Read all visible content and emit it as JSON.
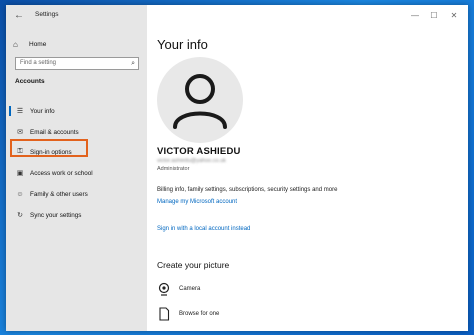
{
  "window": {
    "app_title": "Settings",
    "back_glyph": "←",
    "minimize_glyph": "—",
    "maximize_glyph": "☐",
    "close_glyph": "✕"
  },
  "sidebar": {
    "home_label": "Home",
    "search_placeholder": "Find a setting",
    "section_label": "Accounts",
    "items": [
      {
        "label": "Your info",
        "icon": "person-card-icon",
        "glyph": "☰",
        "active": true
      },
      {
        "label": "Email & accounts",
        "icon": "mail-icon",
        "glyph": "✉",
        "active": false
      },
      {
        "label": "Sign-in options",
        "icon": "key-icon",
        "glyph": "⚿",
        "active": false,
        "highlighted": true
      },
      {
        "label": "Access work or school",
        "icon": "briefcase-icon",
        "glyph": "▣",
        "active": false
      },
      {
        "label": "Family & other users",
        "icon": "people-icon",
        "glyph": "☺",
        "active": false
      },
      {
        "label": "Sync your settings",
        "icon": "sync-icon",
        "glyph": "↻",
        "active": false
      }
    ]
  },
  "main": {
    "title": "Your info",
    "user_name": "VICTOR ASHIEDU",
    "user_email": "victor.ashiedu@yahoo.co.uk",
    "user_role": "Administrator",
    "billing_text": "Billing info, family settings, subscriptions, security settings and more",
    "manage_link": "Manage my Microsoft account",
    "local_account_link": "Sign in with a local account instead",
    "create_picture_heading": "Create your picture",
    "options": [
      {
        "label": "Camera",
        "icon": "camera-icon"
      },
      {
        "label": "Browse for one",
        "icon": "document-icon"
      }
    ]
  },
  "colors": {
    "accent": "#0067c0",
    "highlight_outline": "#e2621d",
    "sidebar_bg": "#e6e6e6",
    "desktop_bg": "#1b86e0"
  }
}
